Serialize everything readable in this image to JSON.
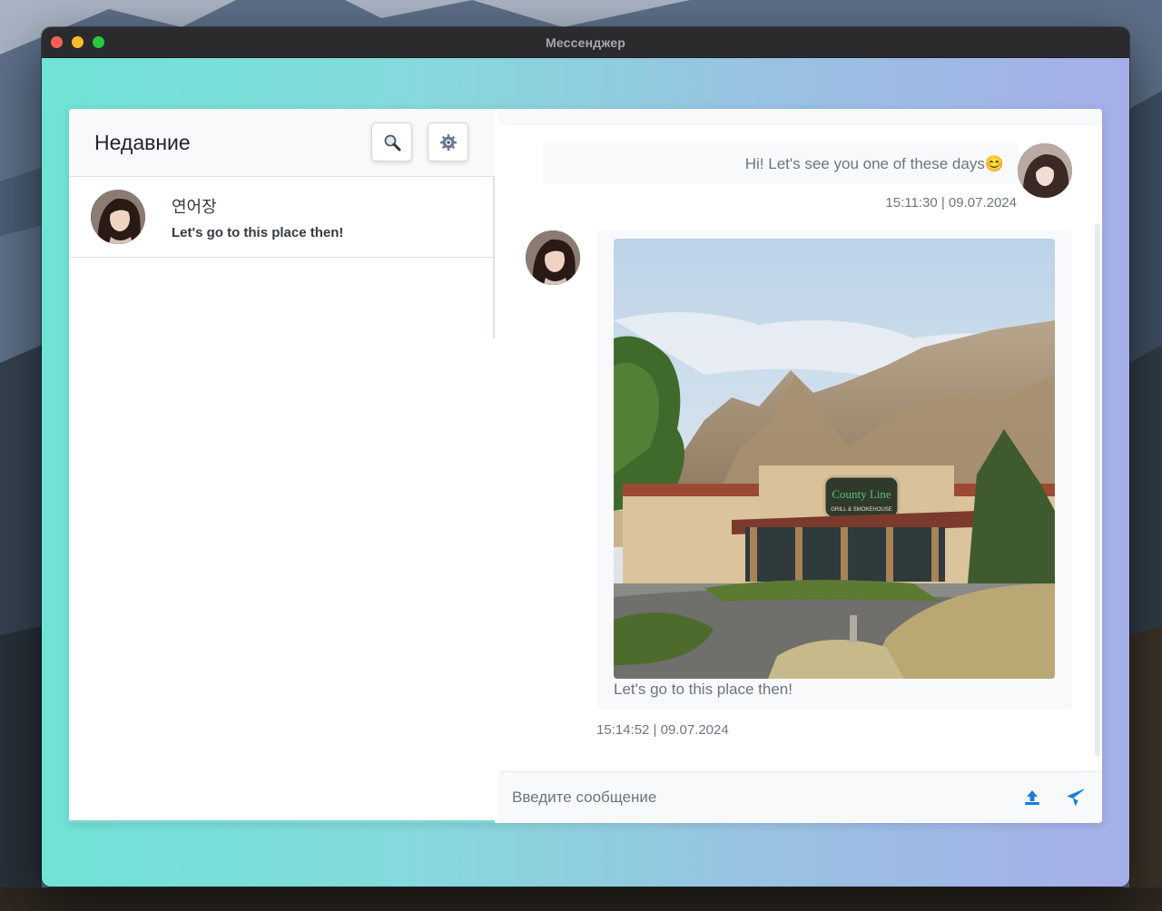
{
  "window": {
    "title": "Мессенджер"
  },
  "sidebar": {
    "title": "Недавние",
    "chats": [
      {
        "name": "연어장",
        "preview": "Let's go to this place then!"
      }
    ]
  },
  "messages": {
    "outgoing_text": "Hi! Let's see you one of these days😊",
    "outgoing_time": "15:11:30 | 09.07.2024",
    "incoming_caption": "Let's go to this place then!",
    "incoming_time": "15:14:52 | 09.07.2024",
    "incoming_image_sign": "THE COUNTY LINE GRILL & SMOKEHOUSE"
  },
  "composer": {
    "placeholder": "Введите сообщение"
  },
  "colors": {
    "accent": "#1a7fd6",
    "muted_text": "#6c757d"
  },
  "icons": [
    "search-icon",
    "gear-icon",
    "upload-icon",
    "send-icon"
  ]
}
